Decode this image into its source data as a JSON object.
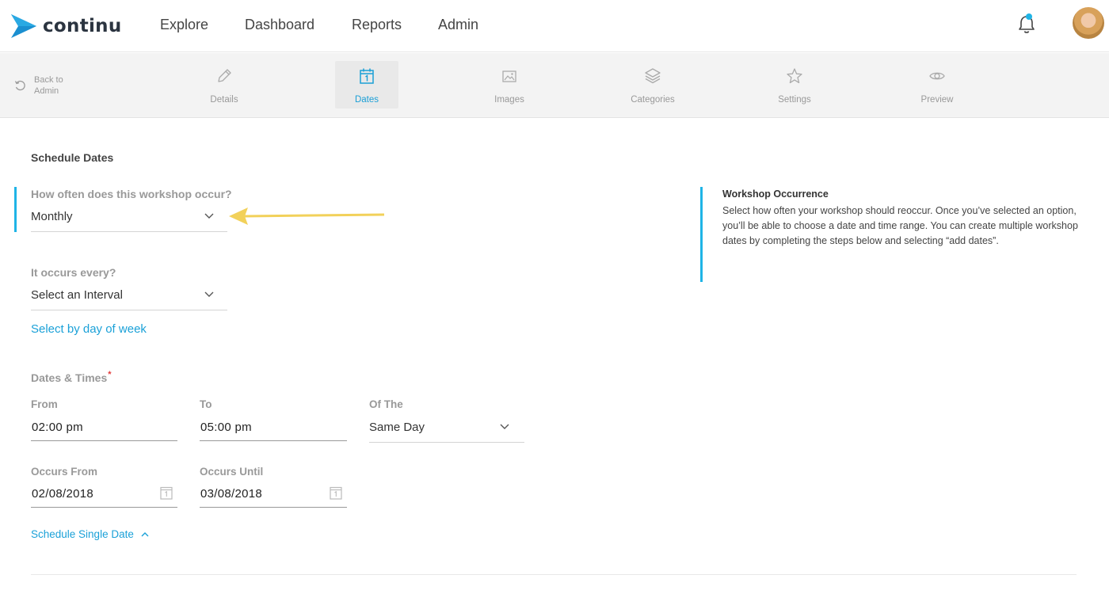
{
  "brand": {
    "name": "continu",
    "accent": "#1fb4e6"
  },
  "topnav": {
    "links": [
      "Explore",
      "Dashboard",
      "Reports",
      "Admin"
    ],
    "notification_icon": "bell-icon",
    "avatar_icon": "user-avatar"
  },
  "subnav": {
    "back_label_line1": "Back to",
    "back_label_line2": "Admin",
    "tabs": [
      {
        "label": "Details",
        "icon": "pencil-icon"
      },
      {
        "label": "Dates",
        "icon": "calendar-icon",
        "active": true
      },
      {
        "label": "Images",
        "icon": "image-icon"
      },
      {
        "label": "Categories",
        "icon": "layers-icon"
      },
      {
        "label": "Settings",
        "icon": "star-icon"
      },
      {
        "label": "Preview",
        "icon": "eye-icon"
      }
    ]
  },
  "form": {
    "section_title": "Schedule Dates",
    "frequency": {
      "label": "How often does this workshop occur?",
      "value": "Monthly"
    },
    "interval": {
      "label": "It occurs every?",
      "value": "Select an Interval"
    },
    "day_of_week_link": "Select by day of week",
    "dates_times": {
      "label": "Dates & Times",
      "required_mark": "*"
    },
    "from": {
      "label": "From",
      "value": "02:00 pm"
    },
    "to": {
      "label": "To",
      "value": "05:00 pm"
    },
    "of_the": {
      "label": "Of The",
      "value": "Same Day"
    },
    "occurs_from": {
      "label": "Occurs From",
      "value": "02/08/2018"
    },
    "occurs_until": {
      "label": "Occurs Until",
      "value": "03/08/2018"
    },
    "single_date_link": "Schedule Single Date"
  },
  "help": {
    "title": "Workshop Occurrence",
    "body": "Select how often your workshop should reoccur. Once you’ve selected an option, you’ll be able to choose a date and time range. You can create multiple workshop dates by completing the steps below and selecting “add dates”."
  },
  "annotation": {
    "arrow_color": "#f2d15a"
  }
}
